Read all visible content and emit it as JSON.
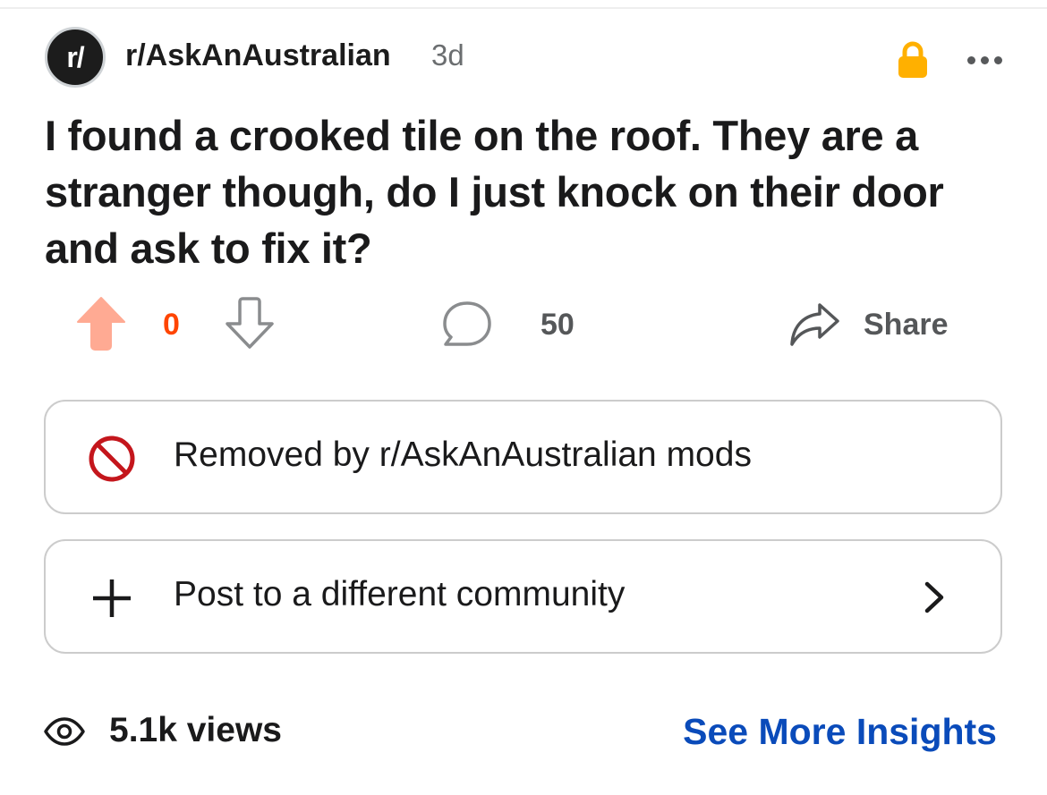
{
  "post": {
    "subreddit_avatar_text": "r/",
    "subreddit": "r/AskAnAustralian",
    "age": "3d",
    "title": "I found a crooked tile on the roof. They are a stranger though, do I just knock on their door and ask to fix it?"
  },
  "actions": {
    "score": "0",
    "comments": "50",
    "share_label": "Share"
  },
  "notices": {
    "removed_text": "Removed by r/AskAnAustralian mods",
    "crosspost_text": "Post to a different community"
  },
  "footer": {
    "views": "5.1k views",
    "insights_label": "See More Insights"
  },
  "colors": {
    "upvote": "#ffaa93",
    "score": "#ff4500",
    "lock": "#ffb000",
    "ban": "#c4161c",
    "link": "#0a4bba"
  },
  "icons": [
    "lock-icon",
    "more-icon",
    "upvote-icon",
    "downvote-icon",
    "comment-icon",
    "share-icon",
    "ban-icon",
    "plus-icon",
    "chevron-right-icon",
    "eye-icon"
  ]
}
